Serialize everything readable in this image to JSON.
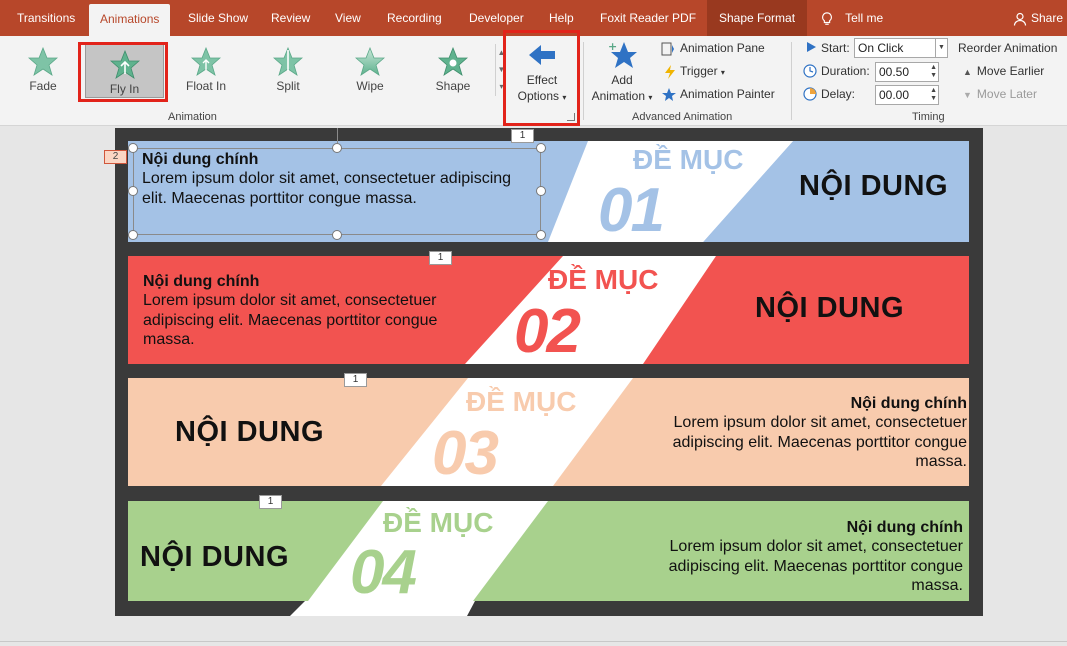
{
  "ribbon_tabs": {
    "transitions": "Transitions",
    "animations": "Animations",
    "slide_show": "Slide Show",
    "review": "Review",
    "view": "View",
    "recording": "Recording",
    "developer": "Developer",
    "help": "Help",
    "foxit": "Foxit Reader PDF",
    "shape_format": "Shape Format"
  },
  "tell_me": "Tell me",
  "share": "Share",
  "animation_gallery": {
    "fade": "Fade",
    "fly_in": "Fly In",
    "float_in": "Float In",
    "split": "Split",
    "wipe": "Wipe",
    "shape": "Shape",
    "group_label": "Animation"
  },
  "effect_options": {
    "line1": "Effect",
    "line2": "Options"
  },
  "advanced": {
    "add_line1": "Add",
    "add_line2": "Animation",
    "animation_pane": "Animation Pane",
    "trigger": "Trigger",
    "animation_painter": "Animation Painter",
    "group_label": "Advanced Animation"
  },
  "timing": {
    "start_label": "Start:",
    "start_value": "On Click",
    "duration_label": "Duration:",
    "duration_value": "00.50",
    "delay_label": "Delay:",
    "delay_value": "00.00",
    "reorder": "Reorder Animation",
    "move_earlier": "Move Earlier",
    "move_later": "Move Later",
    "group_label": "Timing"
  },
  "colors": {
    "accent_red": "#b7472a",
    "band1": "#a4c2e6",
    "band2": "#f25350",
    "band3": "#f8cbad",
    "band4": "#a8d18d"
  },
  "slide": {
    "rows": [
      {
        "heading": "Nội dung chính",
        "body": "Lorem ipsum dolor sit amet, consectetuer adipiscing elit. Maecenas porttitor congue massa.",
        "section": "ĐỀ MỤC",
        "number": "01",
        "label": "NỘI DUNG",
        "tag": "1"
      },
      {
        "heading": "Nội dung chính",
        "body": "Lorem ipsum dolor sit amet, consectetuer adipiscing elit. Maecenas porttitor congue massa.",
        "section": "ĐỀ MỤC",
        "number": "02",
        "label": "NỘI DUNG",
        "tag": "1"
      },
      {
        "heading": "Nội dung chính",
        "body": "Lorem ipsum dolor sit amet, consectetuer adipiscing elit. Maecenas porttitor congue massa.",
        "section": "ĐỀ MỤC",
        "number": "03",
        "label": "NỘI DUNG",
        "tag": "1"
      },
      {
        "heading": "Nội dung chính",
        "body": "Lorem ipsum dolor sit amet, consectetuer adipiscing elit. Maecenas porttitor congue massa.",
        "section": "ĐỀ MỤC",
        "number": "04",
        "label": "NỘI DUNG",
        "tag": "1"
      }
    ],
    "selected_tag": "2"
  }
}
